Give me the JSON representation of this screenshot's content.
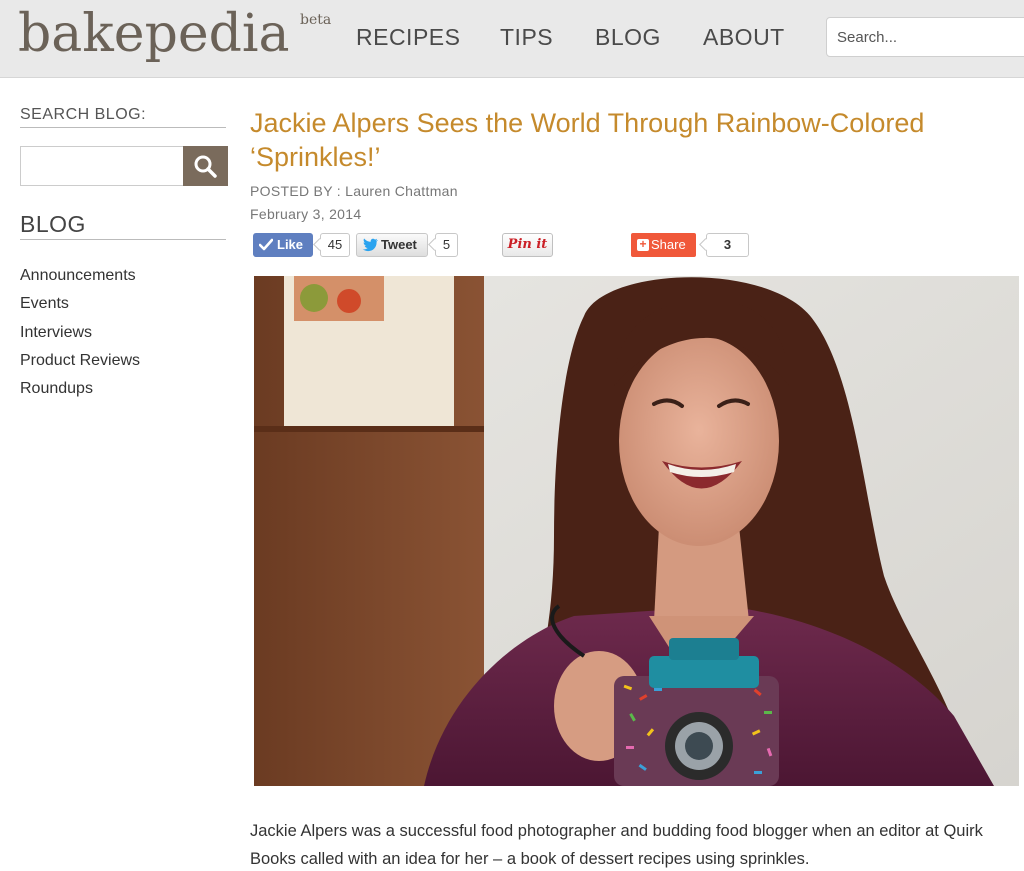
{
  "header": {
    "logo": "bakepedia",
    "logo_badge": "beta",
    "nav": {
      "recipes": "RECIPES",
      "tips": "TIPS",
      "blog": "BLOG",
      "about": "ABOUT"
    },
    "search_placeholder": "Search..."
  },
  "sidebar": {
    "search_heading": "SEARCH BLOG:",
    "blog_heading": "BLOG",
    "categories": [
      "Announcements",
      "Events",
      "Interviews",
      "Product Reviews",
      "Roundups"
    ]
  },
  "post": {
    "title": "Jackie Alpers Sees the World Through Rainbow-Colored ‘Sprinkles!’",
    "posted_by": "POSTED BY : Lauren Chattman",
    "date": "February 3, 2014",
    "social": {
      "like_label": "Like",
      "like_count": "45",
      "tweet_label": "Tweet",
      "tweet_count": "5",
      "pin_label": "Pin it",
      "share_label": "Share",
      "share_count": "3"
    },
    "body": "Jackie Alpers was a successful food photographer and budding food blogger when an editor at Quirk Books called with an idea for her – a book of dessert recipes using sprinkles."
  },
  "colors": {
    "header_bg": "#e9e9e9",
    "logo": "#6b6258",
    "title": "#c58a2c",
    "search_button": "#7a6b5c",
    "like": "#5f7fc0",
    "share": "#f0583a",
    "pin": "#cb2027"
  }
}
